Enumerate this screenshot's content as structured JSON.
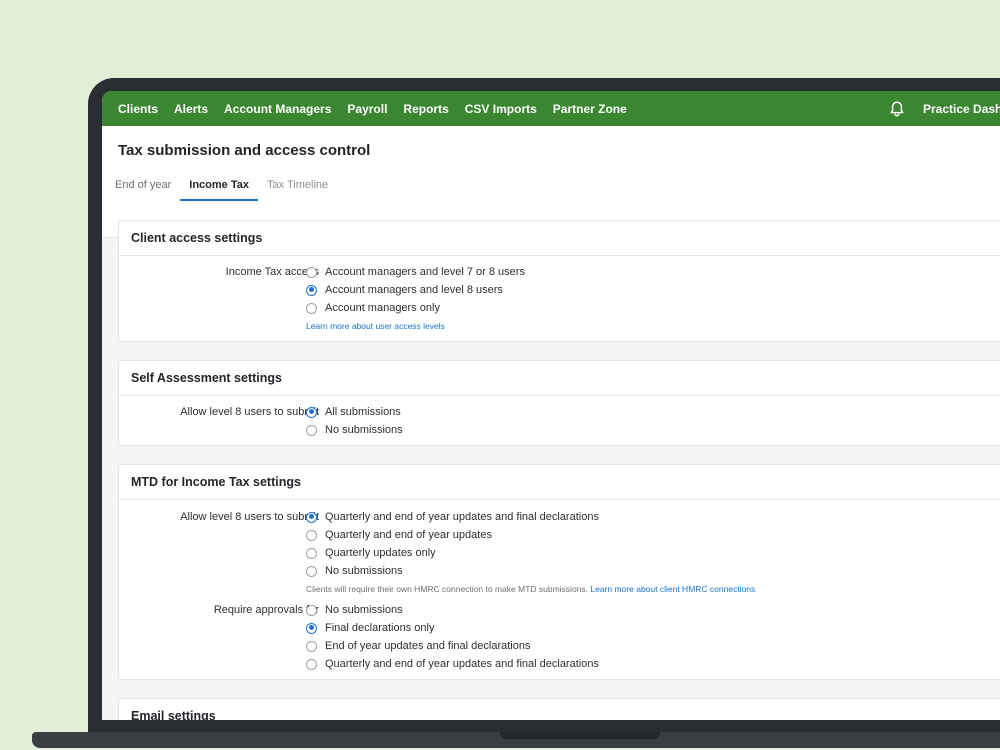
{
  "nav": {
    "items": [
      "Clients",
      "Alerts",
      "Account Managers",
      "Payroll",
      "Reports",
      "CSV Imports",
      "Partner Zone"
    ],
    "right_label": "Practice Dashb"
  },
  "page": {
    "title": "Tax submission and access control",
    "tabs": [
      {
        "label": "End of year",
        "state": "normal"
      },
      {
        "label": "Income Tax",
        "state": "active"
      },
      {
        "label": "Tax Timeline",
        "state": "muted"
      }
    ]
  },
  "client_access": {
    "title": "Client access settings",
    "income_tax_access": {
      "label": "Income Tax access",
      "options": [
        "Account managers and level 7 or 8 users",
        "Account managers and level 8 users",
        "Account managers only"
      ],
      "selected": 1
    },
    "learn_more": "Learn more about user access levels"
  },
  "self_assessment": {
    "title": "Self Assessment settings",
    "allow_submit": {
      "label": "Allow level 8 users to submit",
      "options": [
        "All submissions",
        "No submissions"
      ],
      "selected": 0
    }
  },
  "mtd": {
    "title": "MTD for Income Tax settings",
    "allow_submit": {
      "label": "Allow level 8 users to submit",
      "options": [
        "Quarterly and end of year updates and final declarations",
        "Quarterly and end of year updates",
        "Quarterly updates only",
        "No submissions"
      ],
      "selected": 0
    },
    "help_text": "Clients will require their own HMRC connection to make MTD submissions.",
    "help_link": "Learn more about client HMRC connections",
    "require_approvals": {
      "label": "Require approvals for",
      "options": [
        "No submissions",
        "Final declarations only",
        "End of year updates and final declarations",
        "Quarterly and end of year updates and final declarations"
      ],
      "selected": 1
    }
  },
  "email": {
    "title": "Email settings"
  },
  "colors": {
    "nav_green": "#3a8631",
    "accent_blue": "#1a73c9",
    "background": "#e0efd6"
  },
  "icons": {
    "notifications": "bell-icon"
  }
}
